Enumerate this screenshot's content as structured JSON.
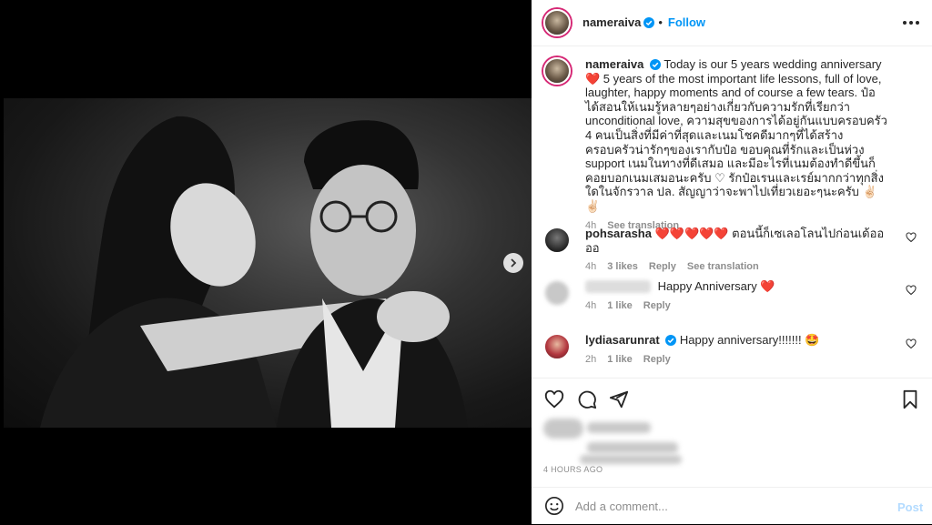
{
  "post": {
    "author": "nameraiva",
    "follow_label": "Follow",
    "separator": "•"
  },
  "caption": {
    "username": "nameraiva",
    "text": "Today is our 5 years wedding anniversary ❤️ 5 years of the most important life lessons, full of love, laughter, happy moments and of course a few tears. ป๋อได้สอนให้เนมรู้หลายๆอย่างเกี่ยวกับความรักที่เรียกว่า unconditional love, ความสุขของการได้อยู่กันแบบครอบครัว 4 คนเป็นสิ่งที่มีค่าที่สุดและเนมโชคดีมากๆที่ได้สร้างครอบครัวน่ารักๆของเรากับป๋อ ขอบคุณที่รักและเป็นห่วง support เนมในทางที่ดีเสมอ และมีอะไรที่เนมต้องทำดีขึ้นก็คอยบอกเนมเสมอนะครับ ♡ รักป๋อเรนและเรย์มากกว่าทุกสิ่งใดในจักรวาล ปล. สัญญาว่าจะพาไปเที่ยวเยอะๆนะครับ ✌🏻✌🏻",
    "time": "4h",
    "see_translation": "See translation"
  },
  "comments": [
    {
      "username": "pohsarasha",
      "text": "❤️❤️❤️❤️❤️ ตอนนี้ก็เซเลอโลนไปก่อนเด้ออออ",
      "time": "4h",
      "likes": "3 likes",
      "reply": "Reply",
      "see_translation": "See translation"
    },
    {
      "username": "",
      "text": "Happy Anniversary ❤️",
      "time": "4h",
      "likes": "1 like",
      "reply": "Reply"
    },
    {
      "username": "lydiasarunrat",
      "text": "Happy anniversary!!!!!!! 🤩",
      "time": "2h",
      "likes": "1 like",
      "reply": "Reply"
    }
  ],
  "footer": {
    "timestamp": "4 HOURS AGO",
    "comment_placeholder": "Add a comment...",
    "post_label": "Post"
  },
  "carousel": {
    "slide_count": 10,
    "active_index": 0
  },
  "colors": {
    "accent": "#0095f6",
    "verified": "#0095f6",
    "heart": "#ed4956",
    "post_disabled": "#b3dbff"
  }
}
